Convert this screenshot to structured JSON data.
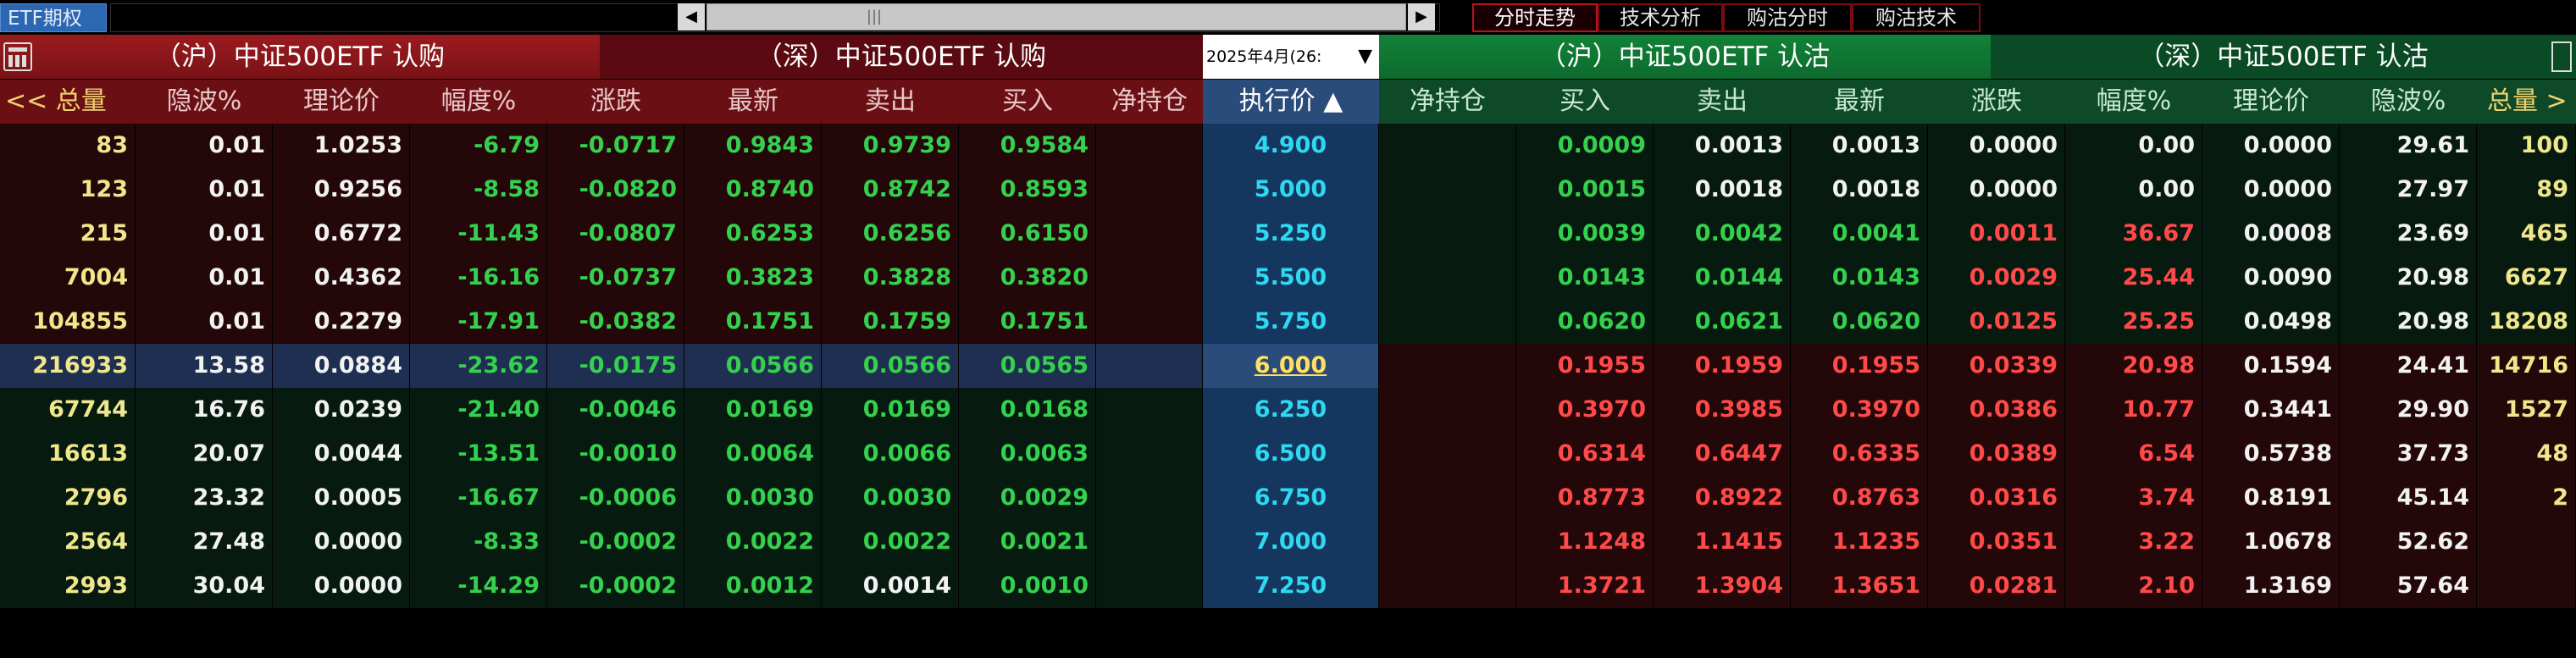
{
  "topbar": {
    "etf_tab": "ETF期权",
    "scroll_grip": "|||",
    "tabs": [
      {
        "label": "分时走势",
        "active": true
      },
      {
        "label": "技术分析",
        "active": false
      },
      {
        "label": "购沽分时",
        "active": false
      },
      {
        "label": "购沽技术",
        "active": false
      }
    ]
  },
  "sections": {
    "sh_call": "（沪）中证500ETF 认购",
    "sz_call": "（深）中证500ETF 认购",
    "expiry": "2025年4月(26:",
    "sh_put": "（沪）中证500ETF 认沽",
    "sz_put": "（深）中证500ETF 认沽"
  },
  "columns": {
    "left": [
      "<< 总量",
      "隐波%",
      "理论价",
      "幅度%",
      "涨跌",
      "最新",
      "卖出",
      "买入",
      "净持仓"
    ],
    "mid": "执行价 ▲",
    "right": [
      "净持仓",
      "买入",
      "卖出",
      "最新",
      "涨跌",
      "幅度%",
      "理论价",
      "隐波%",
      "总量 >"
    ]
  },
  "rows": [
    {
      "cls": "itm",
      "call": [
        "83",
        "0.01",
        "1.0253",
        "-6.79",
        "-0.0717",
        "0.9843",
        "0.9739",
        "0.9584",
        ""
      ],
      "strike": "4.900",
      "put": [
        "",
        "0.0009",
        "0.0013",
        "0.0013",
        "0.0000",
        "0.00",
        "0.0000",
        "29.61",
        "100"
      ]
    },
    {
      "cls": "itm",
      "call": [
        "123",
        "0.01",
        "0.9256",
        "-8.58",
        "-0.0820",
        "0.8740",
        "0.8742",
        "0.8593",
        ""
      ],
      "strike": "5.000",
      "put": [
        "",
        "0.0015",
        "0.0018",
        "0.0018",
        "0.0000",
        "0.00",
        "0.0000",
        "27.97",
        "89"
      ]
    },
    {
      "cls": "itm",
      "call": [
        "215",
        "0.01",
        "0.6772",
        "-11.43",
        "-0.0807",
        "0.6253",
        "0.6256",
        "0.6150",
        ""
      ],
      "strike": "5.250",
      "put": [
        "",
        "0.0039",
        "0.0042",
        "0.0041",
        "0.0011",
        "36.67",
        "0.0008",
        "23.69",
        "465"
      ]
    },
    {
      "cls": "itm",
      "call": [
        "7004",
        "0.01",
        "0.4362",
        "-16.16",
        "-0.0737",
        "0.3823",
        "0.3828",
        "0.3820",
        ""
      ],
      "strike": "5.500",
      "put": [
        "",
        "0.0143",
        "0.0144",
        "0.0143",
        "0.0029",
        "25.44",
        "0.0090",
        "20.98",
        "6627"
      ]
    },
    {
      "cls": "itm",
      "call": [
        "104855",
        "0.01",
        "0.2279",
        "-17.91",
        "-0.0382",
        "0.1751",
        "0.1759",
        "0.1751",
        ""
      ],
      "strike": "5.750",
      "put": [
        "",
        "0.0620",
        "0.0621",
        "0.0620",
        "0.0125",
        "25.25",
        "0.0498",
        "20.98",
        "18208"
      ]
    },
    {
      "cls": "atm",
      "call": [
        "216933",
        "13.58",
        "0.0884",
        "-23.62",
        "-0.0175",
        "0.0566",
        "0.0566",
        "0.0565",
        ""
      ],
      "strike": "6.000",
      "put": [
        "",
        "0.1955",
        "0.1959",
        "0.1955",
        "0.0339",
        "20.98",
        "0.1594",
        "24.41",
        "14716"
      ]
    },
    {
      "cls": "otm",
      "call": [
        "67744",
        "16.76",
        "0.0239",
        "-21.40",
        "-0.0046",
        "0.0169",
        "0.0169",
        "0.0168",
        ""
      ],
      "strike": "6.250",
      "put": [
        "",
        "0.3970",
        "0.3985",
        "0.3970",
        "0.0386",
        "10.77",
        "0.3441",
        "29.90",
        "1527"
      ]
    },
    {
      "cls": "otm",
      "call": [
        "16613",
        "20.07",
        "0.0044",
        "-13.51",
        "-0.0010",
        "0.0064",
        "0.0066",
        "0.0063",
        ""
      ],
      "strike": "6.500",
      "put": [
        "",
        "0.6314",
        "0.6447",
        "0.6335",
        "0.0389",
        "6.54",
        "0.5738",
        "37.73",
        "48"
      ]
    },
    {
      "cls": "otm",
      "call": [
        "2796",
        "23.32",
        "0.0005",
        "-16.67",
        "-0.0006",
        "0.0030",
        "0.0030",
        "0.0029",
        ""
      ],
      "strike": "6.750",
      "put": [
        "",
        "0.8773",
        "0.8922",
        "0.8763",
        "0.0316",
        "3.74",
        "0.8191",
        "45.14",
        "2"
      ]
    },
    {
      "cls": "otm",
      "call": [
        "2564",
        "27.48",
        "0.0000",
        "-8.33",
        "-0.0002",
        "0.0022",
        "0.0022",
        "0.0021",
        ""
      ],
      "strike": "7.000",
      "put": [
        "",
        "1.1248",
        "1.1415",
        "1.1235",
        "0.0351",
        "3.22",
        "1.0678",
        "52.62",
        ""
      ]
    },
    {
      "cls": "otm",
      "call": [
        "2993",
        "30.04",
        "0.0000",
        "-14.29",
        "-0.0002",
        "0.0012",
        "0.0014",
        "0.0010",
        ""
      ],
      "strike": "7.250",
      "put": [
        "",
        "1.3721",
        "1.3904",
        "1.3651",
        "0.0281",
        "2.10",
        "1.3169",
        "57.64",
        ""
      ]
    }
  ],
  "colors": {
    "call_color": "#35d04e",
    "put_color": "#ff4a4a",
    "volume_color": "#f0e68c",
    "strike_color": "#2fd8f0"
  }
}
